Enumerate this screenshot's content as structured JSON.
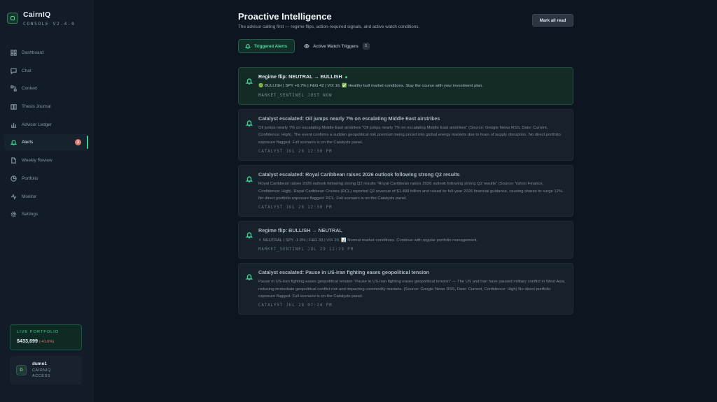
{
  "brand": {
    "name": "CairnIQ",
    "subtitle": "CONSOLE V2.4.0"
  },
  "nav": [
    {
      "label": "Dashboard",
      "icon": "grid-icon"
    },
    {
      "label": "Chat",
      "icon": "chat-icon"
    },
    {
      "label": "Context",
      "icon": "nodes-icon"
    },
    {
      "label": "Thesis Journal",
      "icon": "journal-icon"
    },
    {
      "label": "Advisor Ledger",
      "icon": "ledger-icon"
    },
    {
      "label": "Alerts",
      "icon": "bell-icon",
      "badge": "3",
      "active": true
    },
    {
      "label": "Weekly Review",
      "icon": "document-icon"
    },
    {
      "label": "Portfolio",
      "icon": "pie-icon"
    },
    {
      "label": "Monitor",
      "icon": "activity-icon"
    },
    {
      "label": "Settings",
      "icon": "gear-icon"
    }
  ],
  "live_portfolio": {
    "label": "LIVE PORTFOLIO",
    "value": "$433,699",
    "change": "(-41.6%)"
  },
  "user": {
    "initial": "D",
    "name": "dumo1",
    "line1": "CAIRNIQ",
    "line2": "ACCESS"
  },
  "header": {
    "title": "Proactive Intelligence",
    "subtitle": "The advisor calling first — regime flips, action-required signals, and active watch conditions.",
    "mark_all_read": "Mark all read"
  },
  "tabs": {
    "triggered": "Triggered Alerts",
    "watch": "Active Watch Triggers",
    "watch_count": "1"
  },
  "alerts": [
    {
      "title": "Regime flip: NEUTRAL → BULLISH",
      "body": "🟢 BULLISH | SPY +0.7% | F&G 42 | VIX 16. ✅ Healthy bull market conditions. Stay the course with your investment plan.",
      "meta": "MARKET_SENTINEL   JUST NOW",
      "unread": true
    },
    {
      "title": "Catalyst escalated: Oil jumps nearly 7% on escalating Middle East airstrikes",
      "body": "Oil jumps nearly 7% on escalating Middle East airstrikes \"Oil jumps nearly 7% on escalating Middle East airstrikes\" (Source: Google News RSS, Date: Current, Confidence: High). The event confirms a sudden geopolitical risk premium being priced into global energy markets due to fears of supply disruption. No direct portfolio exposure flagged. Full scenario is on the Catalysts panel.",
      "meta": "CATALYST   JUL 29 12:30 PM",
      "unread": false
    },
    {
      "title": "Catalyst escalated: Royal Caribbean raises 2026 outlook following strong Q2 results",
      "body": "Royal Caribbean raises 2026 outlook following strong Q2 results \"Royal Caribbean raises 2026 outlook following strong Q2 results\" (Source: Yahoo Finance, Confidence: High). Royal Caribbean Cruises (RCL) reported Q2 revenue of $1.499 billion and raised its full-year 2026 financial guidance, causing shares to surge 12%. No direct portfolio exposure flagged: RCL. Full scenario is on the Catalysts panel.",
      "meta": "CATALYST   JUL 29 12:30 PM",
      "unread": false
    },
    {
      "title": "Regime flip: BULLISH → NEUTRAL",
      "body": "⚪ NEUTRAL | SPY -1.0% | F&G 33 | VIX 20. 📊 Normal market conditions. Continue with regular portfolio management.",
      "meta": "MARKET_SENTINEL   JUL 29 12:29 PM",
      "unread": false
    },
    {
      "title": "Catalyst escalated: Pause in US-Iran fighting eases geopolitical tension",
      "body": "Pause in US-Iran fighting eases geopolitical tension \"Pause in US-Iran fighting eases geopolitical tension\" — The US and Iran have paused military conflict in West Asia, reducing immediate geopolitical conflict risk and impacting commodity markets. (Source: Google News RSS, Date: Current, Confidence: High) No direct portfolio exposure flagged. Full scenario is on the Catalysts panel.",
      "meta": "CATALYST   JUL 28 07:24 PM",
      "unread": false
    }
  ],
  "colors": {
    "accent": "#3ecf8e",
    "background": "#0d1520",
    "sidebar": "#111c28",
    "negative": "#e07a6e"
  }
}
